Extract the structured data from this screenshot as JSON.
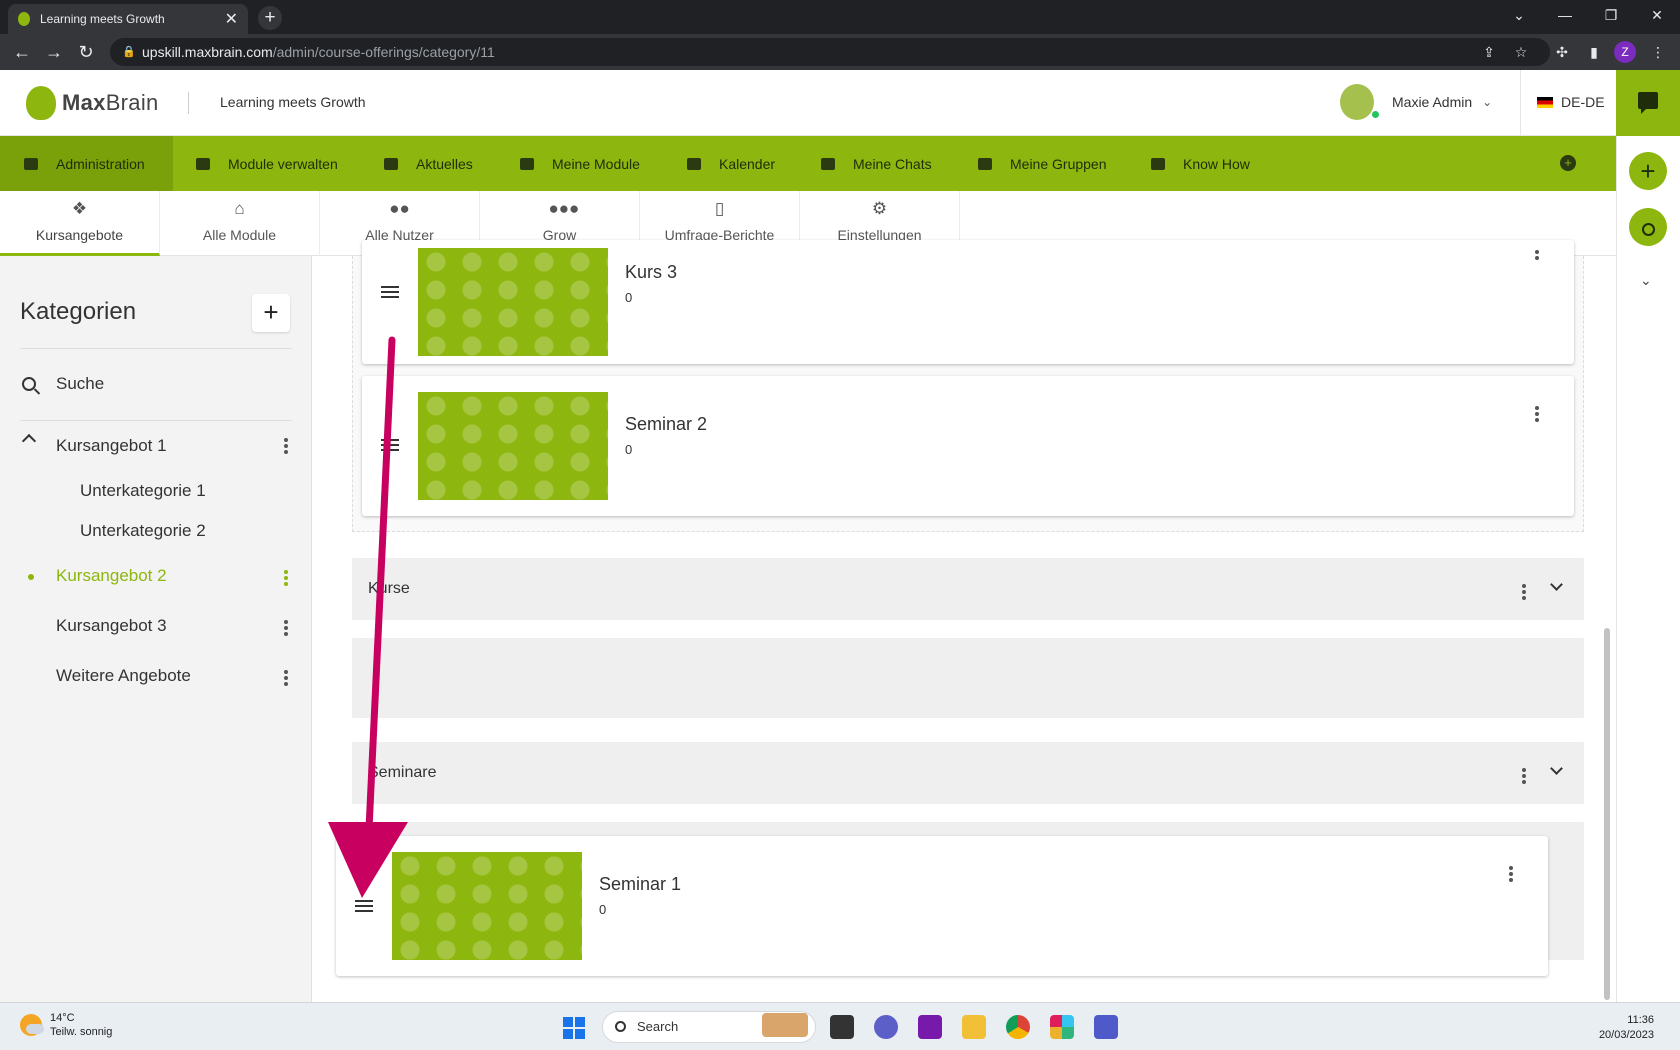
{
  "browser": {
    "tab_title": "Learning meets Growth",
    "url_host": "upskill.maxbrain.com",
    "url_path": "/admin/course-offerings/category/11",
    "profile_initial": "Z"
  },
  "header": {
    "logo_bold": "Max",
    "logo_light": "Brain",
    "tagline": "Learning meets Growth",
    "user_name": "Maxie Admin",
    "language": "DE-DE"
  },
  "nav": {
    "items": [
      {
        "label": "Administration",
        "icon": "administration-icon"
      },
      {
        "label": "Module verwalten",
        "icon": "folder-icon"
      },
      {
        "label": "Aktuelles",
        "icon": "news-icon"
      },
      {
        "label": "Meine Module",
        "icon": "graduation-cap-icon"
      },
      {
        "label": "Kalender",
        "icon": "calendar-icon"
      },
      {
        "label": "Meine Chats",
        "icon": "chat-icon"
      },
      {
        "label": "Meine Gruppen",
        "icon": "group-folder-icon"
      },
      {
        "label": "Know How",
        "icon": "book-icon"
      }
    ]
  },
  "subtabs": [
    {
      "label": "Kursangebote",
      "icon": "course-offer-icon"
    },
    {
      "label": "Alle Module",
      "icon": "institution-icon"
    },
    {
      "label": "Alle Nutzer",
      "icon": "users-icon"
    },
    {
      "label": "Grow",
      "icon": "team-icon"
    },
    {
      "label": "Umfrage-Berichte",
      "icon": "report-icon"
    },
    {
      "label": "Einstellungen",
      "icon": "gears-icon"
    }
  ],
  "sidebar": {
    "title": "Kategorien",
    "search_label": "Suche",
    "items": [
      {
        "label": "Kursangebot 1"
      },
      {
        "label": "Unterkategorie 1"
      },
      {
        "label": "Unterkategorie 2"
      },
      {
        "label": "Kursangebot 2"
      },
      {
        "label": "Kursangebot 3"
      },
      {
        "label": "Weitere Angebote"
      }
    ]
  },
  "content": {
    "cards": [
      {
        "title": "Kurs 3",
        "count": "0"
      },
      {
        "title": "Seminar 2",
        "count": "0"
      },
      {
        "title": "Seminar 1",
        "count": "0"
      }
    ],
    "sections": [
      {
        "title": "Kurse"
      },
      {
        "title": "Seminare"
      }
    ]
  },
  "taskbar": {
    "temperature": "14°C",
    "weather": "Teilw. sonnig",
    "search_label": "Search",
    "time": "11:36",
    "date": "20/03/2023"
  },
  "colors": {
    "brand_green": "#8db60e",
    "arrow_magenta": "#c8005f"
  }
}
